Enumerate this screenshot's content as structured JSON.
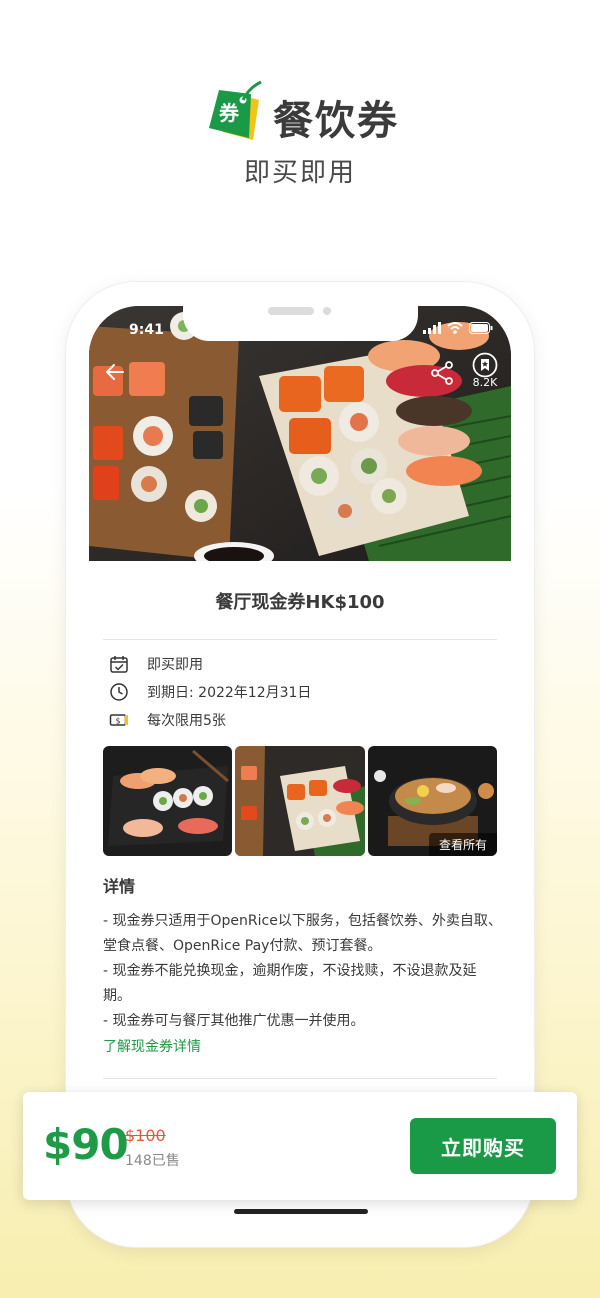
{
  "promo": {
    "title": "餐饮券",
    "subtitle": "即买即用",
    "logo_text": "券"
  },
  "status_bar": {
    "time": "9:41"
  },
  "hero": {
    "bookmark_count": "8.2K"
  },
  "voucher": {
    "title": "餐厅现金券HK$100",
    "info": [
      {
        "icon": "calendar-check-icon",
        "text": "即买即用"
      },
      {
        "icon": "clock-icon",
        "text": "到期日: 2022年12月31日"
      },
      {
        "icon": "cash-icon",
        "text": "每次限用5张"
      }
    ],
    "view_all_label": "查看所有"
  },
  "details": {
    "title": "详情",
    "lines": [
      "- 现金券只适用于OpenRice以下服务，包括餐饮券、外卖自取、堂食点餐、OpenRice Pay付款、预订套餐。",
      "- 现金券不能兑换现金，逾期作废，不设找赎，不设退款及延期。",
      "- 现金券可与餐厅其他推广优惠一并使用。"
    ],
    "link_label": "了解现金券详情"
  },
  "buy_bar": {
    "price": "$90",
    "original_price": "$100",
    "sold_count": "148已售",
    "buy_label": "立即购买"
  },
  "colors": {
    "brand_green": "#1a9a47",
    "strike_red": "#e05a3a",
    "logo_yellow": "#f2c318"
  }
}
